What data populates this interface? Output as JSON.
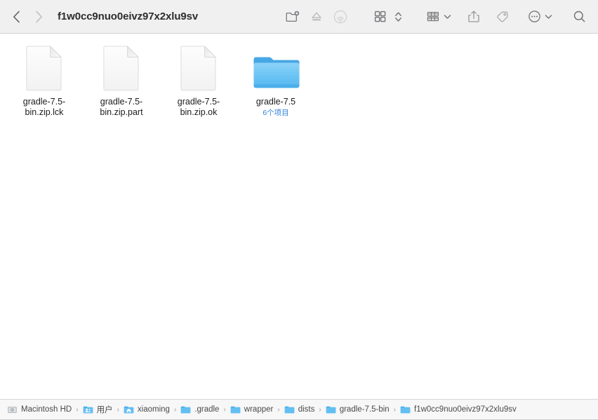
{
  "window": {
    "title": "f1w0cc9nuo0eivz97x2xlu9sv"
  },
  "toolbar": {
    "back": {
      "name": "back-button",
      "icon": "chevron-left-icon",
      "enabled": true
    },
    "forward": {
      "name": "forward-button",
      "icon": "chevron-right-icon",
      "enabled": false
    },
    "buttons": [
      {
        "id": "new-folder",
        "icon": "new-folder-icon",
        "label": "New Folder"
      },
      {
        "id": "eject",
        "icon": "eject-icon",
        "label": "Eject"
      },
      {
        "id": "airdrop",
        "icon": "airdrop-icon",
        "label": "AirDrop"
      },
      {
        "id": "view-icons",
        "icon": "grid-view-icon",
        "label": "Icon View"
      },
      {
        "id": "group-by",
        "icon": "arrange-chevrons-icon",
        "label": "Arrange"
      },
      {
        "id": "view-options",
        "icon": "gallery-list-icon",
        "label": "View Options"
      },
      {
        "id": "share",
        "icon": "share-icon",
        "label": "Share"
      },
      {
        "id": "tags",
        "icon": "tag-icon",
        "label": "Tags"
      },
      {
        "id": "more",
        "icon": "more-circle-icon",
        "label": "More"
      },
      {
        "id": "search",
        "icon": "search-icon",
        "label": "Search"
      }
    ],
    "colors": {
      "icon": "#74757a",
      "icon_dim": "#b6b7bb",
      "background": "#f0f0f0",
      "title": "#2d2d2d"
    }
  },
  "content": {
    "items": [
      {
        "name": "gradle-7.5-bin.zip.lck",
        "label": "gradle-7.5-\nbin.zip.lck",
        "kind": "document",
        "icon": "blank-document-icon",
        "subtitle": ""
      },
      {
        "name": "gradle-7.5-bin.zip.part",
        "label": "gradle-7.5-\nbin.zip.part",
        "kind": "document",
        "icon": "blank-document-icon",
        "subtitle": ""
      },
      {
        "name": "gradle-7.5-bin.zip.ok",
        "label": "gradle-7.5-\nbin.zip.ok",
        "kind": "document",
        "icon": "blank-document-icon",
        "subtitle": ""
      },
      {
        "name": "gradle-7.5",
        "label": "gradle-7.5",
        "kind": "folder",
        "icon": "blue-folder-icon",
        "subtitle": "6个项目"
      }
    ],
    "colors": {
      "background": "#ffffff",
      "label": "#1c1c1e",
      "subtitle": "#2f7fd8",
      "folder_top": "#3c9ee0",
      "folder_body": "#6cc3f4"
    }
  },
  "pathbar": {
    "separator": "›",
    "crumbs": [
      {
        "label": "Macintosh HD",
        "icon": "hard-drive-icon"
      },
      {
        "label": "用户",
        "icon": "users-folder-icon"
      },
      {
        "label": "xiaoming",
        "icon": "home-folder-icon"
      },
      {
        "label": ".gradle",
        "icon": "folder-icon"
      },
      {
        "label": "wrapper",
        "icon": "folder-icon"
      },
      {
        "label": "dists",
        "icon": "folder-icon"
      },
      {
        "label": "gradle-7.5-bin",
        "icon": "folder-icon"
      },
      {
        "label": "f1w0cc9nuo0eivz97x2xlu9sv",
        "icon": "folder-icon"
      }
    ],
    "colors": {
      "background": "#f7f7f7",
      "label": "#4a4a4a",
      "separator": "#9a9a9a"
    }
  }
}
